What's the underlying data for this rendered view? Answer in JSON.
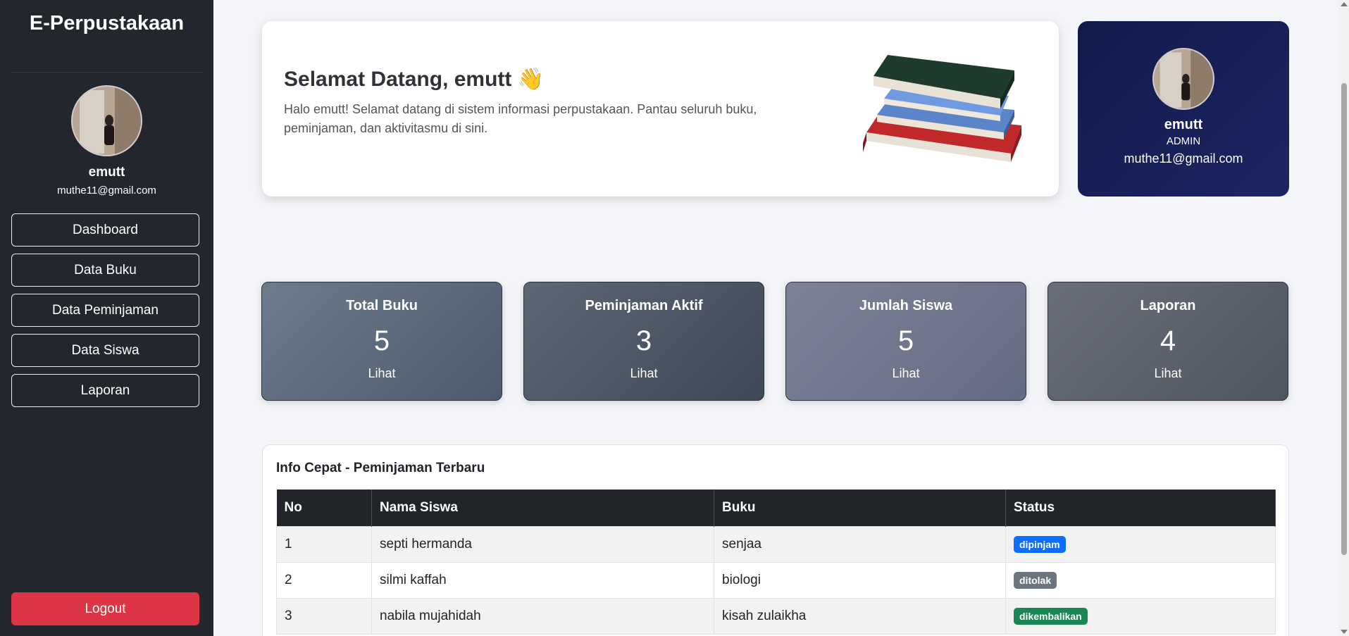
{
  "sidebar": {
    "brand": "E-Perpustakaan",
    "user_name": "emutt",
    "user_email": "muthe11@gmail.com",
    "nav": [
      {
        "label": "Dashboard"
      },
      {
        "label": "Data Buku"
      },
      {
        "label": "Data Peminjaman"
      },
      {
        "label": "Data Siswa"
      },
      {
        "label": "Laporan"
      }
    ],
    "logout_label": "Logout"
  },
  "welcome": {
    "title": "Selamat Datang, emutt 👋",
    "text": "Halo emutt! Selamat datang di sistem informasi perpustakaan. Pantau seluruh buku, peminjaman, dan aktivitasmu di sini."
  },
  "profile": {
    "name": "emutt",
    "role": "ADMIN",
    "email": "muthe11@gmail.com"
  },
  "stats": [
    {
      "title": "Total Buku",
      "value": "5",
      "link": "Lihat"
    },
    {
      "title": "Peminjaman Aktif",
      "value": "3",
      "link": "Lihat"
    },
    {
      "title": "Jumlah Siswa",
      "value": "5",
      "link": "Lihat"
    },
    {
      "title": "Laporan",
      "value": "4",
      "link": "Lihat"
    }
  ],
  "info": {
    "title": "Info Cepat - Peminjaman Terbaru",
    "headers": [
      "No",
      "Nama Siswa",
      "Buku",
      "Status"
    ],
    "rows": [
      {
        "no": "1",
        "nama": "septi hermanda",
        "buku": "senjaa",
        "status": "dipinjam",
        "color": "#0d6efd"
      },
      {
        "no": "2",
        "nama": "silmi kaffah",
        "buku": "biologi",
        "status": "ditolak",
        "color": "#6c757d"
      },
      {
        "no": "3",
        "nama": "nabila mujahidah",
        "buku": "kisah zulaikha",
        "status": "dikembalikan",
        "color": "#198754"
      }
    ]
  },
  "colors": {
    "sidebar_bg": "#23272d",
    "logout": "#dc3545",
    "profile_bg": "#161e55"
  }
}
